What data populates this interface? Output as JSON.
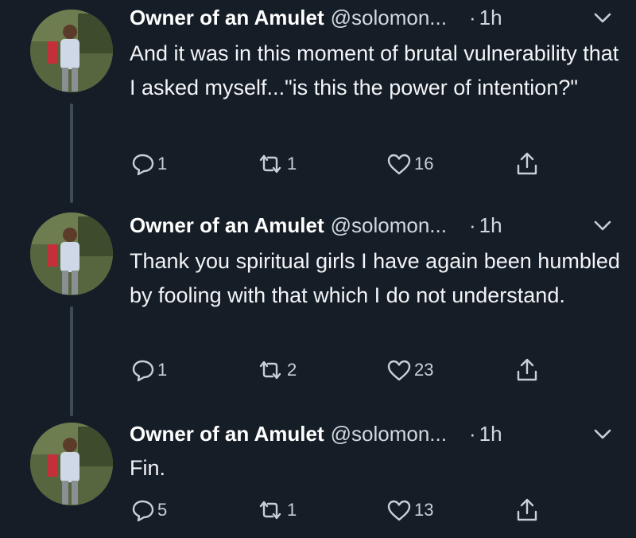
{
  "tweets": [
    {
      "author_name": "Owner of an Amulet",
      "handle": "@solomon...",
      "time": "1h",
      "text": "And it was in this moment of brutal vulnerability that I asked myself...\"is this the power of intention?\"",
      "replies": "1",
      "retweets": "1",
      "likes": "16"
    },
    {
      "author_name": "Owner of an Amulet",
      "handle": "@solomon...",
      "time": "1h",
      "text": "Thank you spiritual girls I have again been humbled by fooling with that which I do not understand.",
      "replies": "1",
      "retweets": "2",
      "likes": "23"
    },
    {
      "author_name": "Owner of an Amulet",
      "handle": "@solomon...",
      "time": "1h",
      "text": "Fin.",
      "replies": "5",
      "retweets": "1",
      "likes": "13"
    }
  ],
  "icons": {
    "reply": "reply-icon",
    "retweet": "retweet-icon",
    "like": "heart-icon",
    "share": "share-icon",
    "menu": "chevron-down-icon"
  },
  "colors": {
    "background": "#151d27",
    "text": "#f2f4f6",
    "secondary": "#c9cfd5",
    "thread_line": "#3f4a55"
  }
}
